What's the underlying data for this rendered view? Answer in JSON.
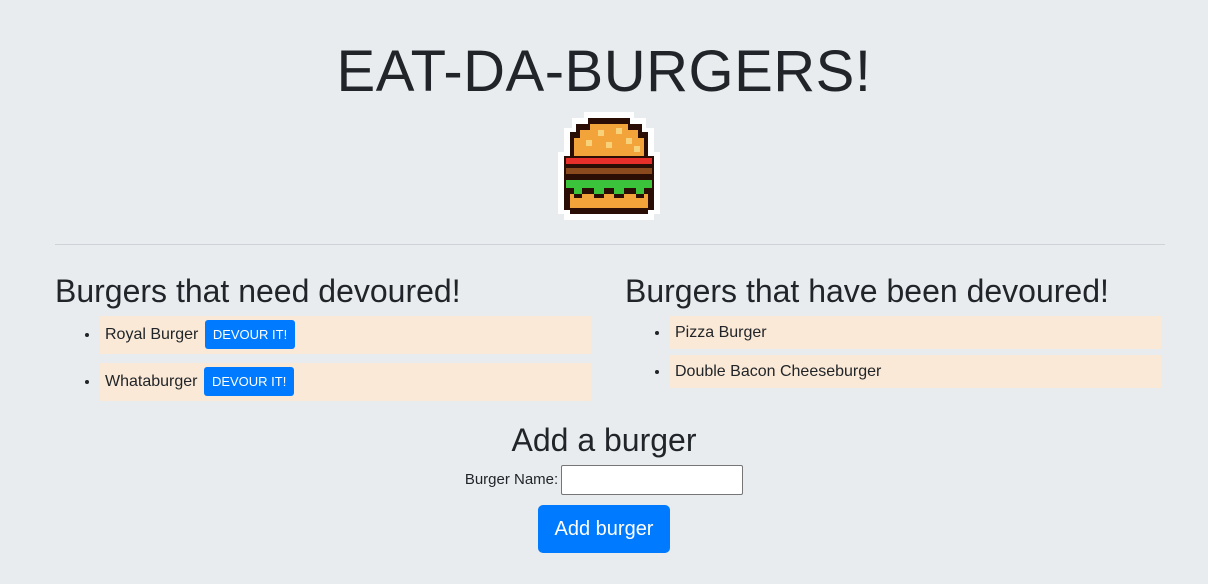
{
  "header": {
    "title": "EAT-DA-BURGERS!",
    "logo_icon": "pixel-burger-icon"
  },
  "left_column": {
    "heading": "Burgers that need devoured!",
    "items": [
      {
        "name": "Royal Burger",
        "button_label": "DEVOUR IT!"
      },
      {
        "name": "Whataburger",
        "button_label": "DEVOUR IT!"
      }
    ]
  },
  "right_column": {
    "heading": "Burgers that have been devoured!",
    "items": [
      {
        "name": "Pizza Burger"
      },
      {
        "name": "Double Bacon Cheeseburger"
      }
    ]
  },
  "add_form": {
    "heading": "Add a burger",
    "label": "Burger Name:",
    "input_value": "",
    "input_placeholder": "",
    "submit_label": "Add burger"
  },
  "colors": {
    "background": "#e9ecef",
    "primary_button": "#007bff",
    "list_item_bg": "#fae9d7"
  }
}
